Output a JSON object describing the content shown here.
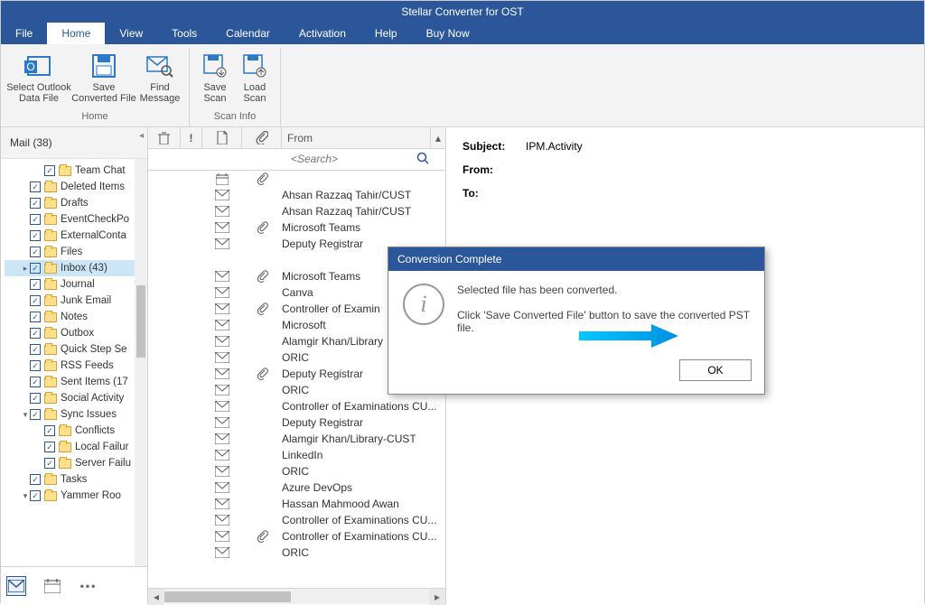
{
  "title": "Stellar Converter for OST",
  "menu": {
    "file": "File",
    "home": "Home",
    "view": "View",
    "tools": "Tools",
    "calendar": "Calendar",
    "activation": "Activation",
    "help": "Help",
    "buynow": "Buy Now"
  },
  "ribbon": {
    "select_outlook": "Select Outlook\nData File",
    "save_converted": "Save\nConverted File",
    "find_message": "Find\nMessage",
    "save_scan": "Save\nScan",
    "load_scan": "Load\nScan",
    "group_home": "Home",
    "group_scan": "Scan Info"
  },
  "nav": {
    "header": "Mail (38)",
    "items": [
      {
        "label": "Team Chat",
        "depth": 2
      },
      {
        "label": "Deleted Items",
        "depth": 1
      },
      {
        "label": "Drafts",
        "depth": 1
      },
      {
        "label": "EventCheckPo",
        "depth": 1
      },
      {
        "label": "ExternalConta",
        "depth": 1
      },
      {
        "label": "Files",
        "depth": 1
      },
      {
        "label": "Inbox (43)",
        "depth": 1,
        "exp": "+",
        "selected": true
      },
      {
        "label": "Journal",
        "depth": 1
      },
      {
        "label": "Junk Email",
        "depth": 1
      },
      {
        "label": "Notes",
        "depth": 1
      },
      {
        "label": "Outbox",
        "depth": 1
      },
      {
        "label": "Quick Step Se",
        "depth": 1
      },
      {
        "label": "RSS Feeds",
        "depth": 1
      },
      {
        "label": "Sent Items (17",
        "depth": 1
      },
      {
        "label": "Social Activity",
        "depth": 1
      },
      {
        "label": "Sync Issues",
        "depth": 1,
        "exp": "-"
      },
      {
        "label": "Conflicts",
        "depth": 2
      },
      {
        "label": "Local Failur",
        "depth": 2
      },
      {
        "label": "Server Failu",
        "depth": 2
      },
      {
        "label": "Tasks",
        "depth": 1
      },
      {
        "label": "Yammer Roo",
        "depth": 1,
        "exp": "-"
      }
    ]
  },
  "list": {
    "col_from": "From",
    "search_ph": "<Search>",
    "rows": [
      {
        "icon": "cal",
        "att": true,
        "from": ""
      },
      {
        "icon": "env",
        "att": false,
        "from": "Ahsan Razzaq Tahir/CUST"
      },
      {
        "icon": "env",
        "att": false,
        "from": "Ahsan Razzaq Tahir/CUST"
      },
      {
        "icon": "env",
        "att": true,
        "from": "Microsoft Teams"
      },
      {
        "icon": "env",
        "att": false,
        "from": "Deputy Registrar"
      },
      {
        "icon": "",
        "att": false,
        "from": ""
      },
      {
        "icon": "env",
        "att": true,
        "from": "Microsoft Teams"
      },
      {
        "icon": "env",
        "att": false,
        "from": "Canva"
      },
      {
        "icon": "env",
        "att": true,
        "from": "Controller of Examin"
      },
      {
        "icon": "env",
        "att": false,
        "from": "Microsoft"
      },
      {
        "icon": "env",
        "att": false,
        "from": "Alamgir Khan/Library"
      },
      {
        "icon": "env",
        "att": false,
        "from": "ORIC"
      },
      {
        "icon": "env",
        "att": true,
        "from": "Deputy Registrar"
      },
      {
        "icon": "env",
        "att": false,
        "from": "ORIC"
      },
      {
        "icon": "env",
        "att": false,
        "from": "Controller of Examinations CU..."
      },
      {
        "icon": "env",
        "att": false,
        "from": "Deputy Registrar"
      },
      {
        "icon": "env",
        "att": false,
        "from": "Alamgir Khan/Library-CUST"
      },
      {
        "icon": "env",
        "att": false,
        "from": "LinkedIn"
      },
      {
        "icon": "env",
        "att": false,
        "from": "ORIC"
      },
      {
        "icon": "env",
        "att": false,
        "from": "Azure DevOps"
      },
      {
        "icon": "env",
        "att": false,
        "from": "Hassan Mahmood Awan"
      },
      {
        "icon": "env",
        "att": false,
        "from": "Controller of Examinations CU..."
      },
      {
        "icon": "env",
        "att": true,
        "from": "Controller of Examinations CU..."
      },
      {
        "icon": "env",
        "att": false,
        "from": "ORIC"
      }
    ]
  },
  "preview": {
    "subject_l": "Subject:",
    "subject_v": "IPM.Activity",
    "from_l": "From:",
    "to_l": "To:"
  },
  "dialog": {
    "title": "Conversion Complete",
    "line1": "Selected file has been converted.",
    "line2": "Click 'Save Converted File' button to save the converted PST file.",
    "ok": "OK"
  }
}
